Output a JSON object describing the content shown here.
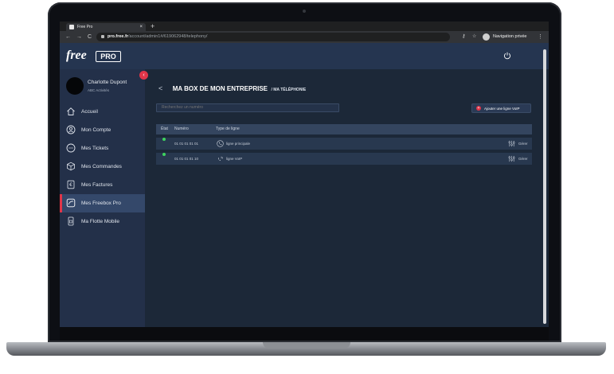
{
  "browser": {
    "tab_title": "Free Pro",
    "tab_close": "×",
    "new_tab": "+",
    "url_domain": "pro.free.fr",
    "url_path": "/account/admin1#/61906294​8/telephony/",
    "private_label": "Navigation privée",
    "back": "←",
    "forward": "→",
    "reload": "C"
  },
  "app": {
    "logo_text": "free",
    "logo_badge": "PRO"
  },
  "user": {
    "name": "Charlotte Dupont",
    "company": "ABC Activités"
  },
  "sidebar": {
    "collapse_symbol": "‹",
    "items": [
      {
        "label": "Accueil",
        "icon": "home-icon"
      },
      {
        "label": "Mon Compte",
        "icon": "account-icon"
      },
      {
        "label": "Mes Tickets",
        "icon": "tickets-icon"
      },
      {
        "label": "Mes Commandes",
        "icon": "orders-icon"
      },
      {
        "label": "Mes Factures",
        "icon": "invoices-icon"
      },
      {
        "label": "Mes Freebox Pro",
        "icon": "freebox-icon",
        "active": true
      },
      {
        "label": "Ma Flotte Mobile",
        "icon": "mobile-fleet-icon"
      }
    ]
  },
  "main": {
    "back_symbol": "<",
    "title": "MA BOX DE MON ENTREPRISE",
    "subtitle": "/ MA TÉLÉPHONIE",
    "search_placeholder": "Recherchez un numéro",
    "add_button": "Ajouter une ligne VoIP",
    "add_symbol": "+",
    "table": {
      "headers": [
        "État",
        "Numéro",
        "Type de ligne"
      ],
      "rows": [
        {
          "status": "active",
          "number": "01 01 01 01 01",
          "type": "ligne principale",
          "type_icon": "phone-icon",
          "action": "Gérer"
        },
        {
          "status": "active",
          "number": "01 01 01 01 10",
          "type": "ligne VoIP",
          "type_icon": "voip-icon",
          "action": "Gérer"
        }
      ]
    }
  },
  "colors": {
    "accent_red": "#e03549",
    "status_green": "#3ed35e",
    "topbar": "#253550",
    "sidebar": "#233049",
    "main_bg": "#1c2838"
  }
}
